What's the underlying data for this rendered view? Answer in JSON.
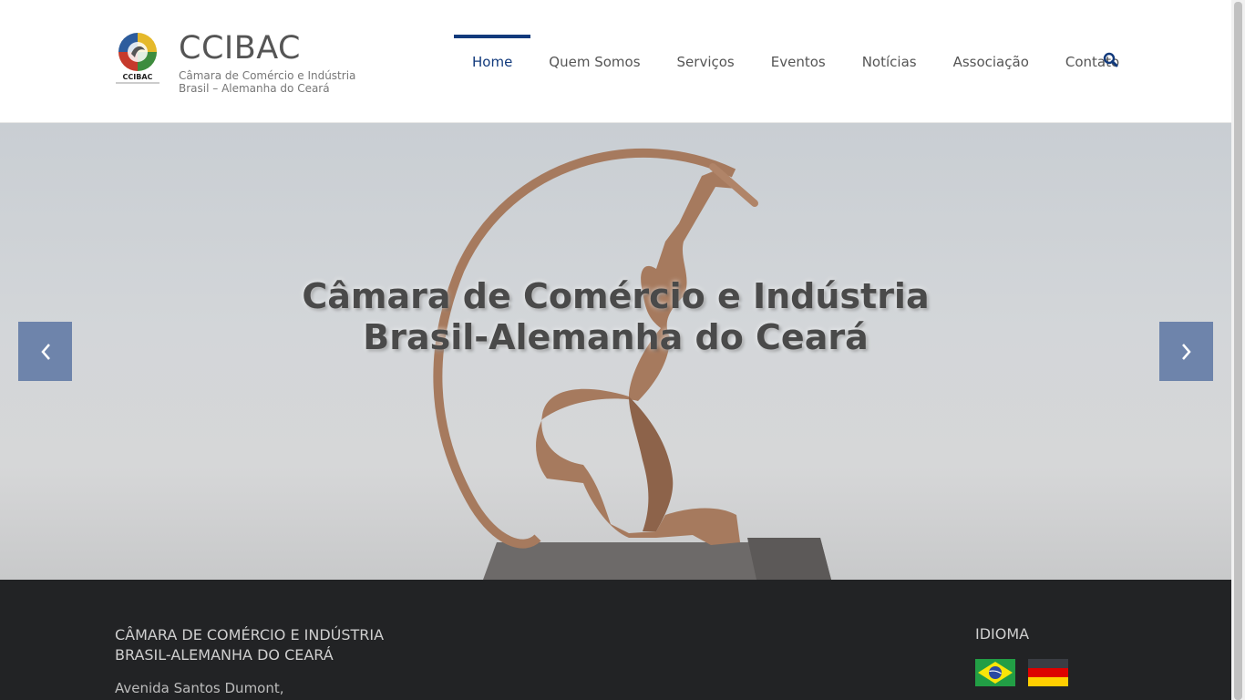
{
  "header": {
    "site_title": "CCIBAC",
    "site_description": "Câmara de Comércio e Indústria Brasil – Alemanha do Ceará",
    "logo_text": "CCIBAC"
  },
  "nav": {
    "items": [
      {
        "label": "Home",
        "active": true
      },
      {
        "label": "Quem Somos",
        "active": false
      },
      {
        "label": "Serviços",
        "active": false
      },
      {
        "label": "Eventos",
        "active": false
      },
      {
        "label": "Notícias",
        "active": false
      },
      {
        "label": "Associação",
        "active": false
      },
      {
        "label": "Contato",
        "active": false
      }
    ],
    "search_icon": "search-icon",
    "accent_color": "#123a7c"
  },
  "slider": {
    "title_line1": "Câmara de Comércio e Indústria",
    "title_line2": "Brasil-Alemanha do Ceará",
    "prev_icon": "chevron-left-icon",
    "next_icon": "chevron-right-icon",
    "arrow_color": "#6e84ab"
  },
  "footer": {
    "org_line1": "CÂMARA DE COMÉRCIO E INDÚSTRIA",
    "org_line2": "BRASIL-ALEMANHA DO CEARÁ",
    "address": "Avenida Santos Dumont,",
    "language_title": "IDIOMA",
    "flags": [
      "brazil-flag-icon",
      "germany-flag-icon"
    ],
    "background": "#222325"
  }
}
